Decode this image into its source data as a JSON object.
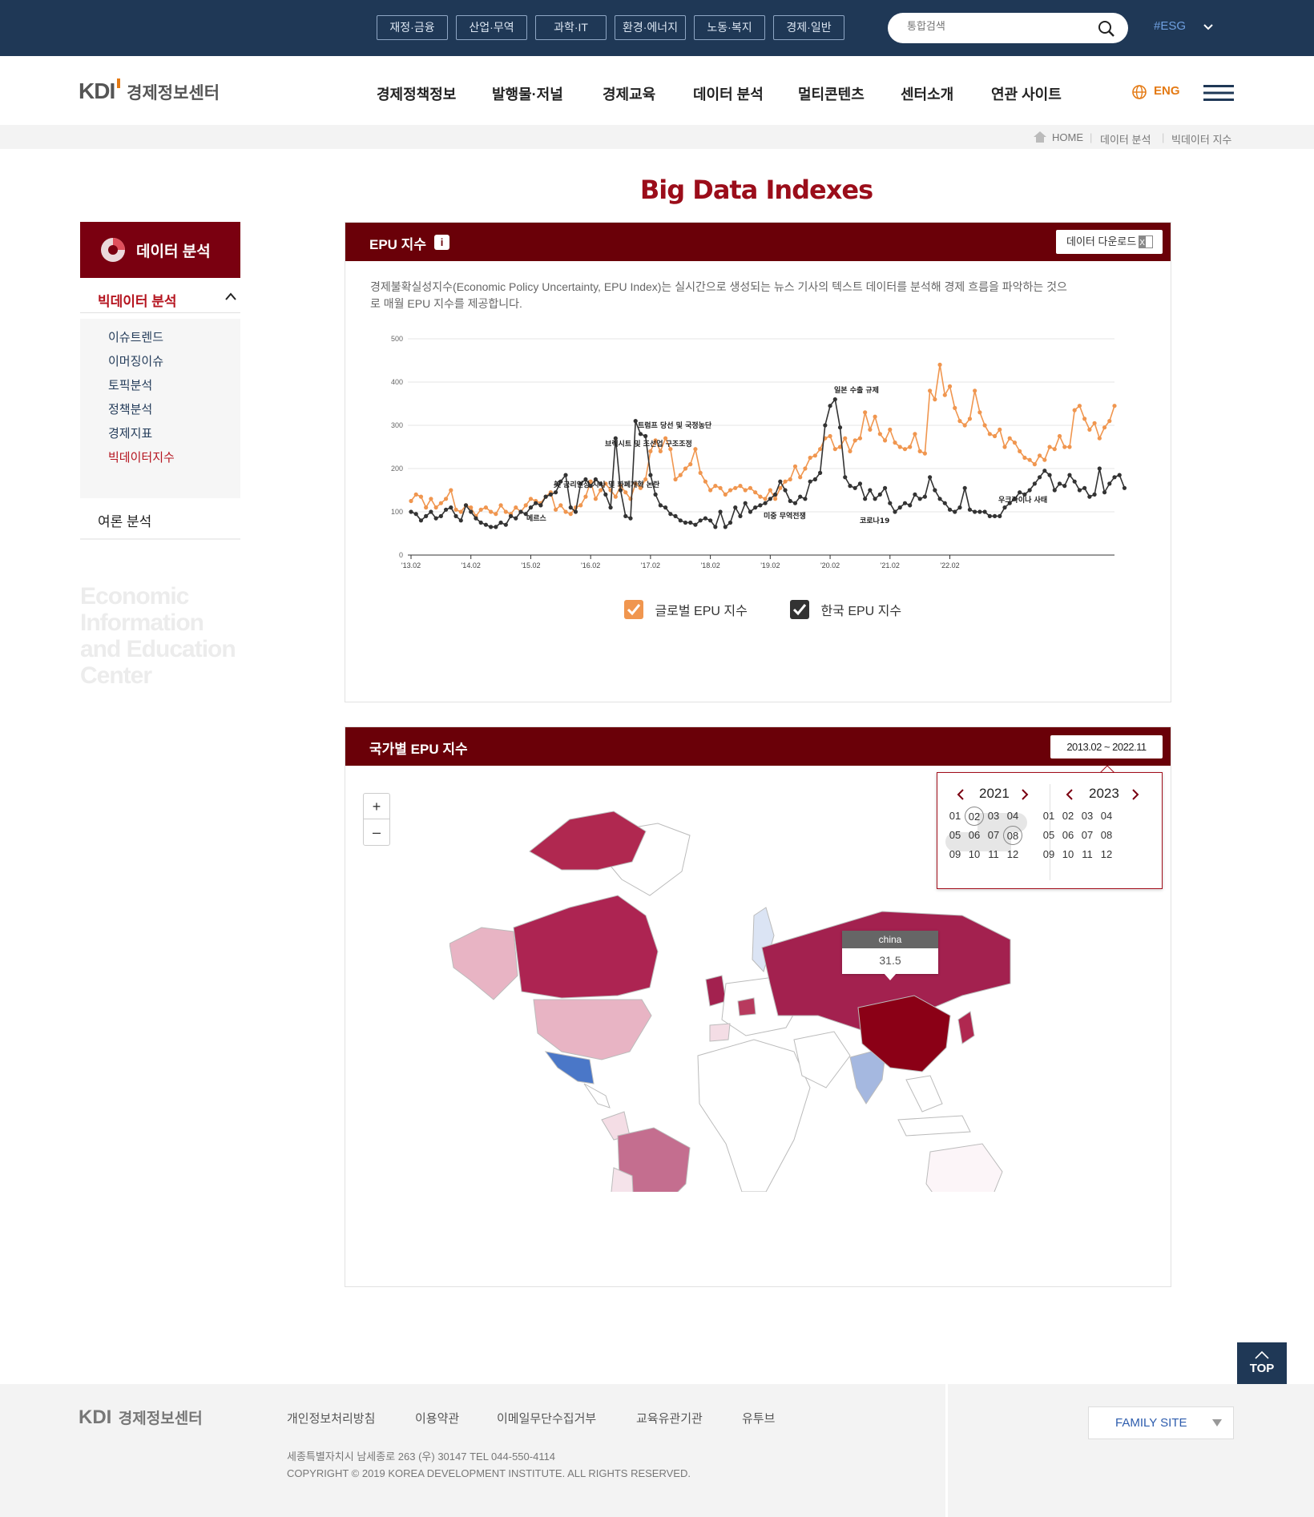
{
  "topbar": {
    "categories": [
      "재정·금융",
      "산업·무역",
      "과학·IT",
      "환경·에너지",
      "노동·복지",
      "경제·일반"
    ],
    "search_placeholder": "통합검색",
    "esg": "#ESG"
  },
  "nav": {
    "logo_kdi": "KDI",
    "logo_name": "경제정보센터",
    "items": [
      "경제정책정보",
      "발행물·저널",
      "경제교육",
      "데이터 분석",
      "멀티콘텐츠",
      "센터소개",
      "연관 사이트"
    ],
    "lang": "ENG"
  },
  "breadcrumb": [
    "HOME",
    "데이터 분석",
    "빅데이터 지수"
  ],
  "page_title": "Big Data Indexes",
  "sidebar": {
    "heading": "데이터 분석",
    "sub1": "빅데이터 분석",
    "items": [
      "이슈트렌드",
      "이머징이슈",
      "토픽분석",
      "정책분석",
      "경제지표",
      "빅데이터지수"
    ],
    "sub2": "여론 분석",
    "bigtext": [
      "Economic",
      "Information",
      "and Education",
      "Center"
    ]
  },
  "epu_panel": {
    "title": "EPU 지수",
    "download": "데이터 다운로드",
    "description": "경제불확실성지수(Economic Policy Uncertainty, EPU Index)는 실시간으로 생성되는 뉴스 기사의 텍스트 데이터를 분석해 경제 흐름을 파악하는 것으로 매월 EPU 지수를 제공합니다.",
    "legend": [
      "글로벌 EPU 지수",
      "한국 EPU 지수"
    ]
  },
  "chart_data": {
    "type": "line",
    "ylim": [
      0,
      500
    ],
    "yticks": [
      0,
      100,
      200,
      300,
      400,
      500
    ],
    "xtick_labels": [
      "'13.02",
      "'14.02",
      "'15.02",
      "'16.02",
      "'17.02",
      "'18.02",
      "'19.02",
      "'20.02",
      "'21.02",
      "'22.02"
    ],
    "colors": {
      "global": "#f0964f",
      "korea": "#333333"
    },
    "series": [
      {
        "name": "글로벌 EPU 지수",
        "values": [
          125,
          140,
          135,
          110,
          130,
          110,
          120,
          130,
          150,
          105,
          100,
          115,
          110,
          90,
          105,
          110,
          100,
          95,
          115,
          100,
          95,
          110,
          100,
          115,
          130,
          125,
          120,
          135,
          145,
          105,
          115,
          100,
          95,
          110,
          115,
          135,
          170,
          130,
          150,
          165,
          150,
          135,
          160,
          145,
          130,
          165,
          155,
          175,
          240,
          265,
          240,
          270,
          245,
          175,
          185,
          200,
          210,
          245,
          190,
          170,
          150,
          160,
          155,
          140,
          150,
          155,
          160,
          150,
          155,
          145,
          135,
          130,
          150,
          130,
          155,
          170,
          175,
          205,
          180,
          200,
          225,
          230,
          245,
          270,
          275,
          245,
          250,
          270,
          240,
          265,
          270,
          330,
          290,
          320,
          280,
          265,
          290,
          260,
          250,
          245,
          250,
          280,
          240,
          235,
          380,
          360,
          440,
          370,
          390,
          340,
          310,
          300,
          315,
          380,
          330,
          300,
          280,
          275,
          290,
          250,
          270,
          260,
          240,
          225,
          220,
          210,
          230,
          220,
          250,
          245,
          275,
          250,
          250,
          335,
          345,
          315,
          290,
          305,
          270,
          295,
          310,
          345
        ]
      },
      {
        "name": "한국 EPU 지수",
        "values": [
          100,
          95,
          80,
          90,
          100,
          85,
          90,
          105,
          110,
          90,
          80,
          115,
          100,
          85,
          75,
          70,
          65,
          65,
          75,
          70,
          90,
          85,
          100,
          95,
          110,
          120,
          115,
          135,
          140,
          145,
          170,
          185,
          110,
          100,
          165,
          175,
          160,
          175,
          165,
          140,
          110,
          270,
          150,
          90,
          85,
          310,
          280,
          275,
          185,
          140,
          115,
          110,
          95,
          90,
          80,
          75,
          75,
          70,
          80,
          85,
          80,
          65,
          100,
          65,
          75,
          110,
          90,
          120,
          100,
          110,
          115,
          120,
          130,
          140,
          170,
          150,
          125,
          120,
          135,
          130,
          170,
          175,
          190,
          300,
          345,
          360,
          295,
          180,
          160,
          155,
          165,
          130,
          150,
          130,
          140,
          155,
          120,
          100,
          110,
          120,
          115,
          140,
          130,
          135,
          180,
          150,
          130,
          120,
          105,
          100,
          110,
          155,
          105,
          100,
          100,
          100,
          90,
          90,
          90,
          110,
          120,
          130,
          145,
          140,
          150,
          165,
          180,
          195,
          185,
          150,
          165,
          160,
          185,
          170,
          150,
          155,
          135,
          140,
          200,
          145,
          165,
          180,
          185,
          155
        ]
      }
    ],
    "annotations": [
      "美 금리인상 시사 및 화폐개혁 논란",
      "메르스",
      "브렉시트 및 조선업 구조조정",
      "트럼프 당선 및 국정농단",
      "미중 무역전쟁",
      "일본 수출 규제",
      "코로나19",
      "우크라이나 사태"
    ]
  },
  "map_panel": {
    "title": "국가별 EPU 지수",
    "range": "2013.02 ~ 2022.11",
    "zoom_in": "+",
    "zoom_out": "–",
    "picker": {
      "left_year": "2021",
      "right_year": "2023",
      "months": [
        "01",
        "02",
        "03",
        "04",
        "05",
        "06",
        "07",
        "08",
        "09",
        "10",
        "11",
        "12"
      ]
    },
    "tooltip": {
      "name": "china",
      "value": "31.5"
    }
  },
  "footer": {
    "links": [
      "개인정보처리방침",
      "이용약관",
      "이메일무단수집거부",
      "교육유관기관",
      "유투브"
    ],
    "address": "세종특별자치시 남세종로 263 (우) 30147  TEL 044-550-4114",
    "copyright": "COPYRIGHT © 2019 KOREA DEVELOPMENT INSTITUTE. ALL RIGHTS RESERVED.",
    "family_site": "FAMILY SITE",
    "top": "TOP"
  }
}
